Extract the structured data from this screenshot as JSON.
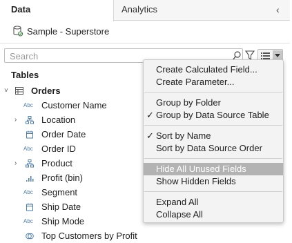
{
  "tabs": {
    "data": "Data",
    "analytics": "Analytics"
  },
  "datasource": {
    "name": "Sample - Superstore"
  },
  "search": {
    "placeholder": "Search"
  },
  "tables": {
    "header": "Tables",
    "table_name": "Orders",
    "fields": [
      {
        "label": "Customer Name",
        "type": "Abc"
      },
      {
        "label": "Location",
        "type": "hierarchy"
      },
      {
        "label": "Order Date",
        "type": "date"
      },
      {
        "label": "Order ID",
        "type": "Abc"
      },
      {
        "label": "Product",
        "type": "hierarchy"
      },
      {
        "label": "Profit (bin)",
        "type": "bin"
      },
      {
        "label": "Segment",
        "type": "Abc"
      },
      {
        "label": "Ship Date",
        "type": "date"
      },
      {
        "label": "Ship Mode",
        "type": "Abc"
      },
      {
        "label": "Top Customers by Profit",
        "type": "set"
      }
    ]
  },
  "menu": {
    "create_calculated_field": "Create Calculated Field...",
    "create_parameter": "Create Parameter...",
    "group_by_folder": "Group by Folder",
    "group_by_data_source_table": "Group by Data Source Table",
    "sort_by_name": "Sort by Name",
    "sort_by_data_source_order": "Sort by Data Source Order",
    "hide_all_unused_fields": "Hide All Unused Fields",
    "show_hidden_fields": "Show Hidden Fields",
    "expand_all": "Expand All",
    "collapse_all": "Collapse All",
    "checkmark": "✓"
  },
  "icons": {
    "type_abc": "Abc",
    "chevron_right": "›",
    "chevron_down": "˅",
    "collapse": "‹"
  },
  "colors": {
    "highlight": "#b3b3b3",
    "type_icon": "#4a7cb1"
  }
}
